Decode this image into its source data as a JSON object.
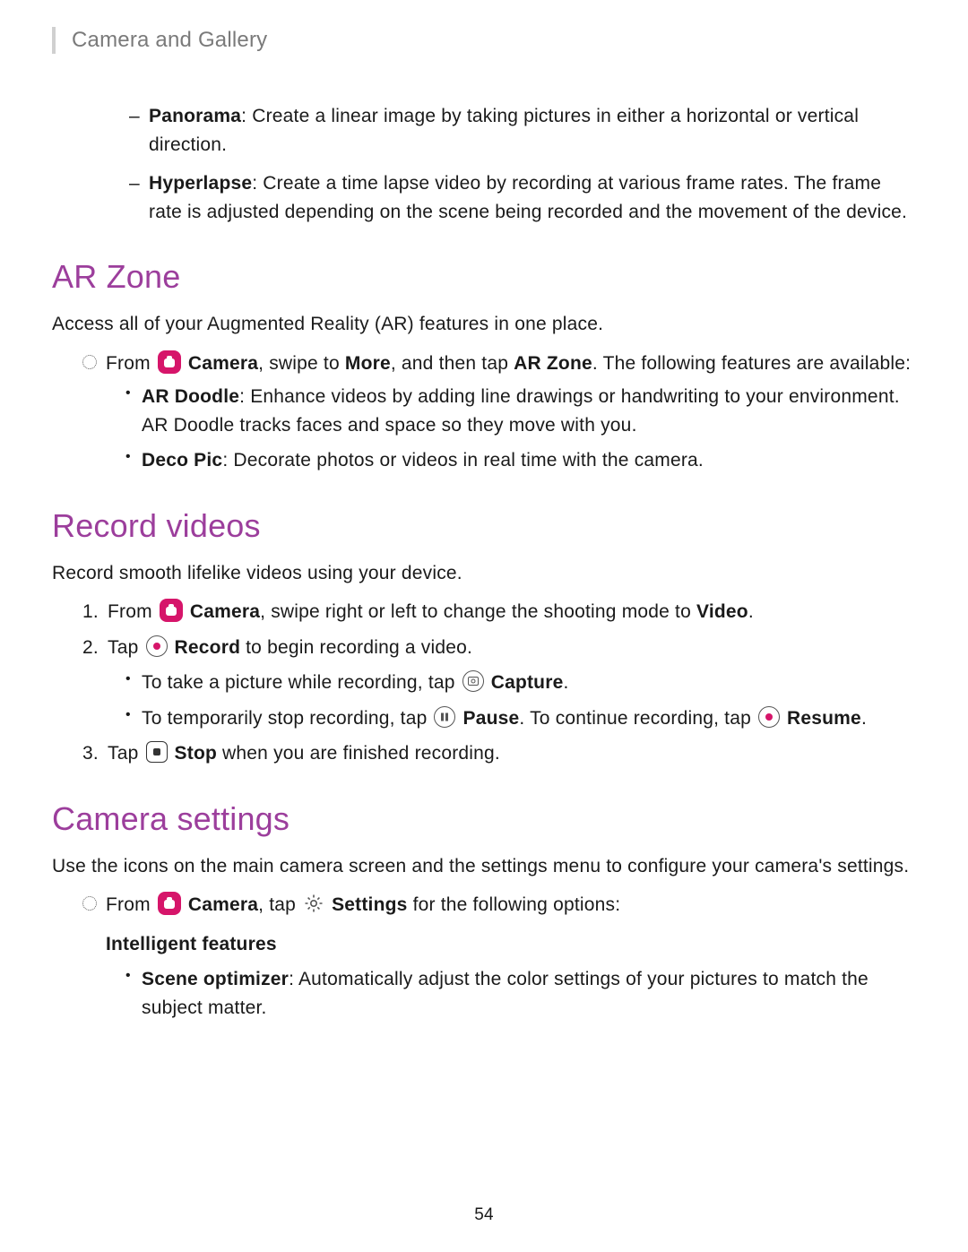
{
  "header": "Camera and Gallery",
  "top_list": {
    "panorama": {
      "label": "Panorama",
      "text": ": Create a linear image by taking pictures in either a horizontal or vertical direction."
    },
    "hyperlapse": {
      "label": "Hyperlapse",
      "text": ": Create a time lapse video by recording at various frame rates. The frame rate is adjusted depending on the scene being recorded and the movement of the device."
    }
  },
  "ar": {
    "heading": "AR Zone",
    "intro": "Access all of your Augmented Reality (AR) features in one place.",
    "step_prefix": "From ",
    "camera_label": "Camera",
    "step_mid": ", swipe to ",
    "more_label": "More",
    "step_mid2": ", and then tap ",
    "arzone_label": "AR Zone",
    "step_suffix": ". The following features are available:",
    "doodle": {
      "label": "AR Doodle",
      "text": ": Enhance videos by adding line drawings or handwriting to your environment. AR Doodle tracks faces and space so they move with you."
    },
    "deco": {
      "label": "Deco Pic",
      "text": ": Decorate photos or videos in real time with the camera."
    }
  },
  "record": {
    "heading": "Record videos",
    "intro": "Record smooth lifelike videos using your device.",
    "n1": "1.",
    "s1_prefix": "From ",
    "camera_label": "Camera",
    "s1_mid": ", swipe right or left to change the shooting mode to ",
    "video_label": "Video",
    "s1_suffix": ".",
    "n2": "2.",
    "s2_prefix": "Tap ",
    "record_label": "Record",
    "s2_suffix": " to begin recording a video.",
    "sub1_prefix": "To take a picture while recording, tap ",
    "capture_label": "Capture",
    "sub1_suffix": ".",
    "sub2_prefix": "To temporarily stop recording, tap ",
    "pause_label": "Pause",
    "sub2_mid": ". To continue recording, tap ",
    "resume_label": "Resume",
    "sub2_suffix": ".",
    "n3": "3.",
    "s3_prefix": "Tap ",
    "stop_label": "Stop",
    "s3_suffix": " when you are finished recording."
  },
  "settings": {
    "heading": "Camera settings",
    "intro": "Use the icons on the main camera screen and the settings menu to configure your camera's settings.",
    "step_prefix": "From ",
    "camera_label": "Camera",
    "step_mid": ", tap ",
    "settings_label": "Settings",
    "step_suffix": " for the following options:",
    "subheading": "Intelligent features",
    "scene": {
      "label": "Scene optimizer",
      "text": ": Automatically adjust the color settings of your pictures to match the subject matter."
    }
  },
  "page_number": "54"
}
